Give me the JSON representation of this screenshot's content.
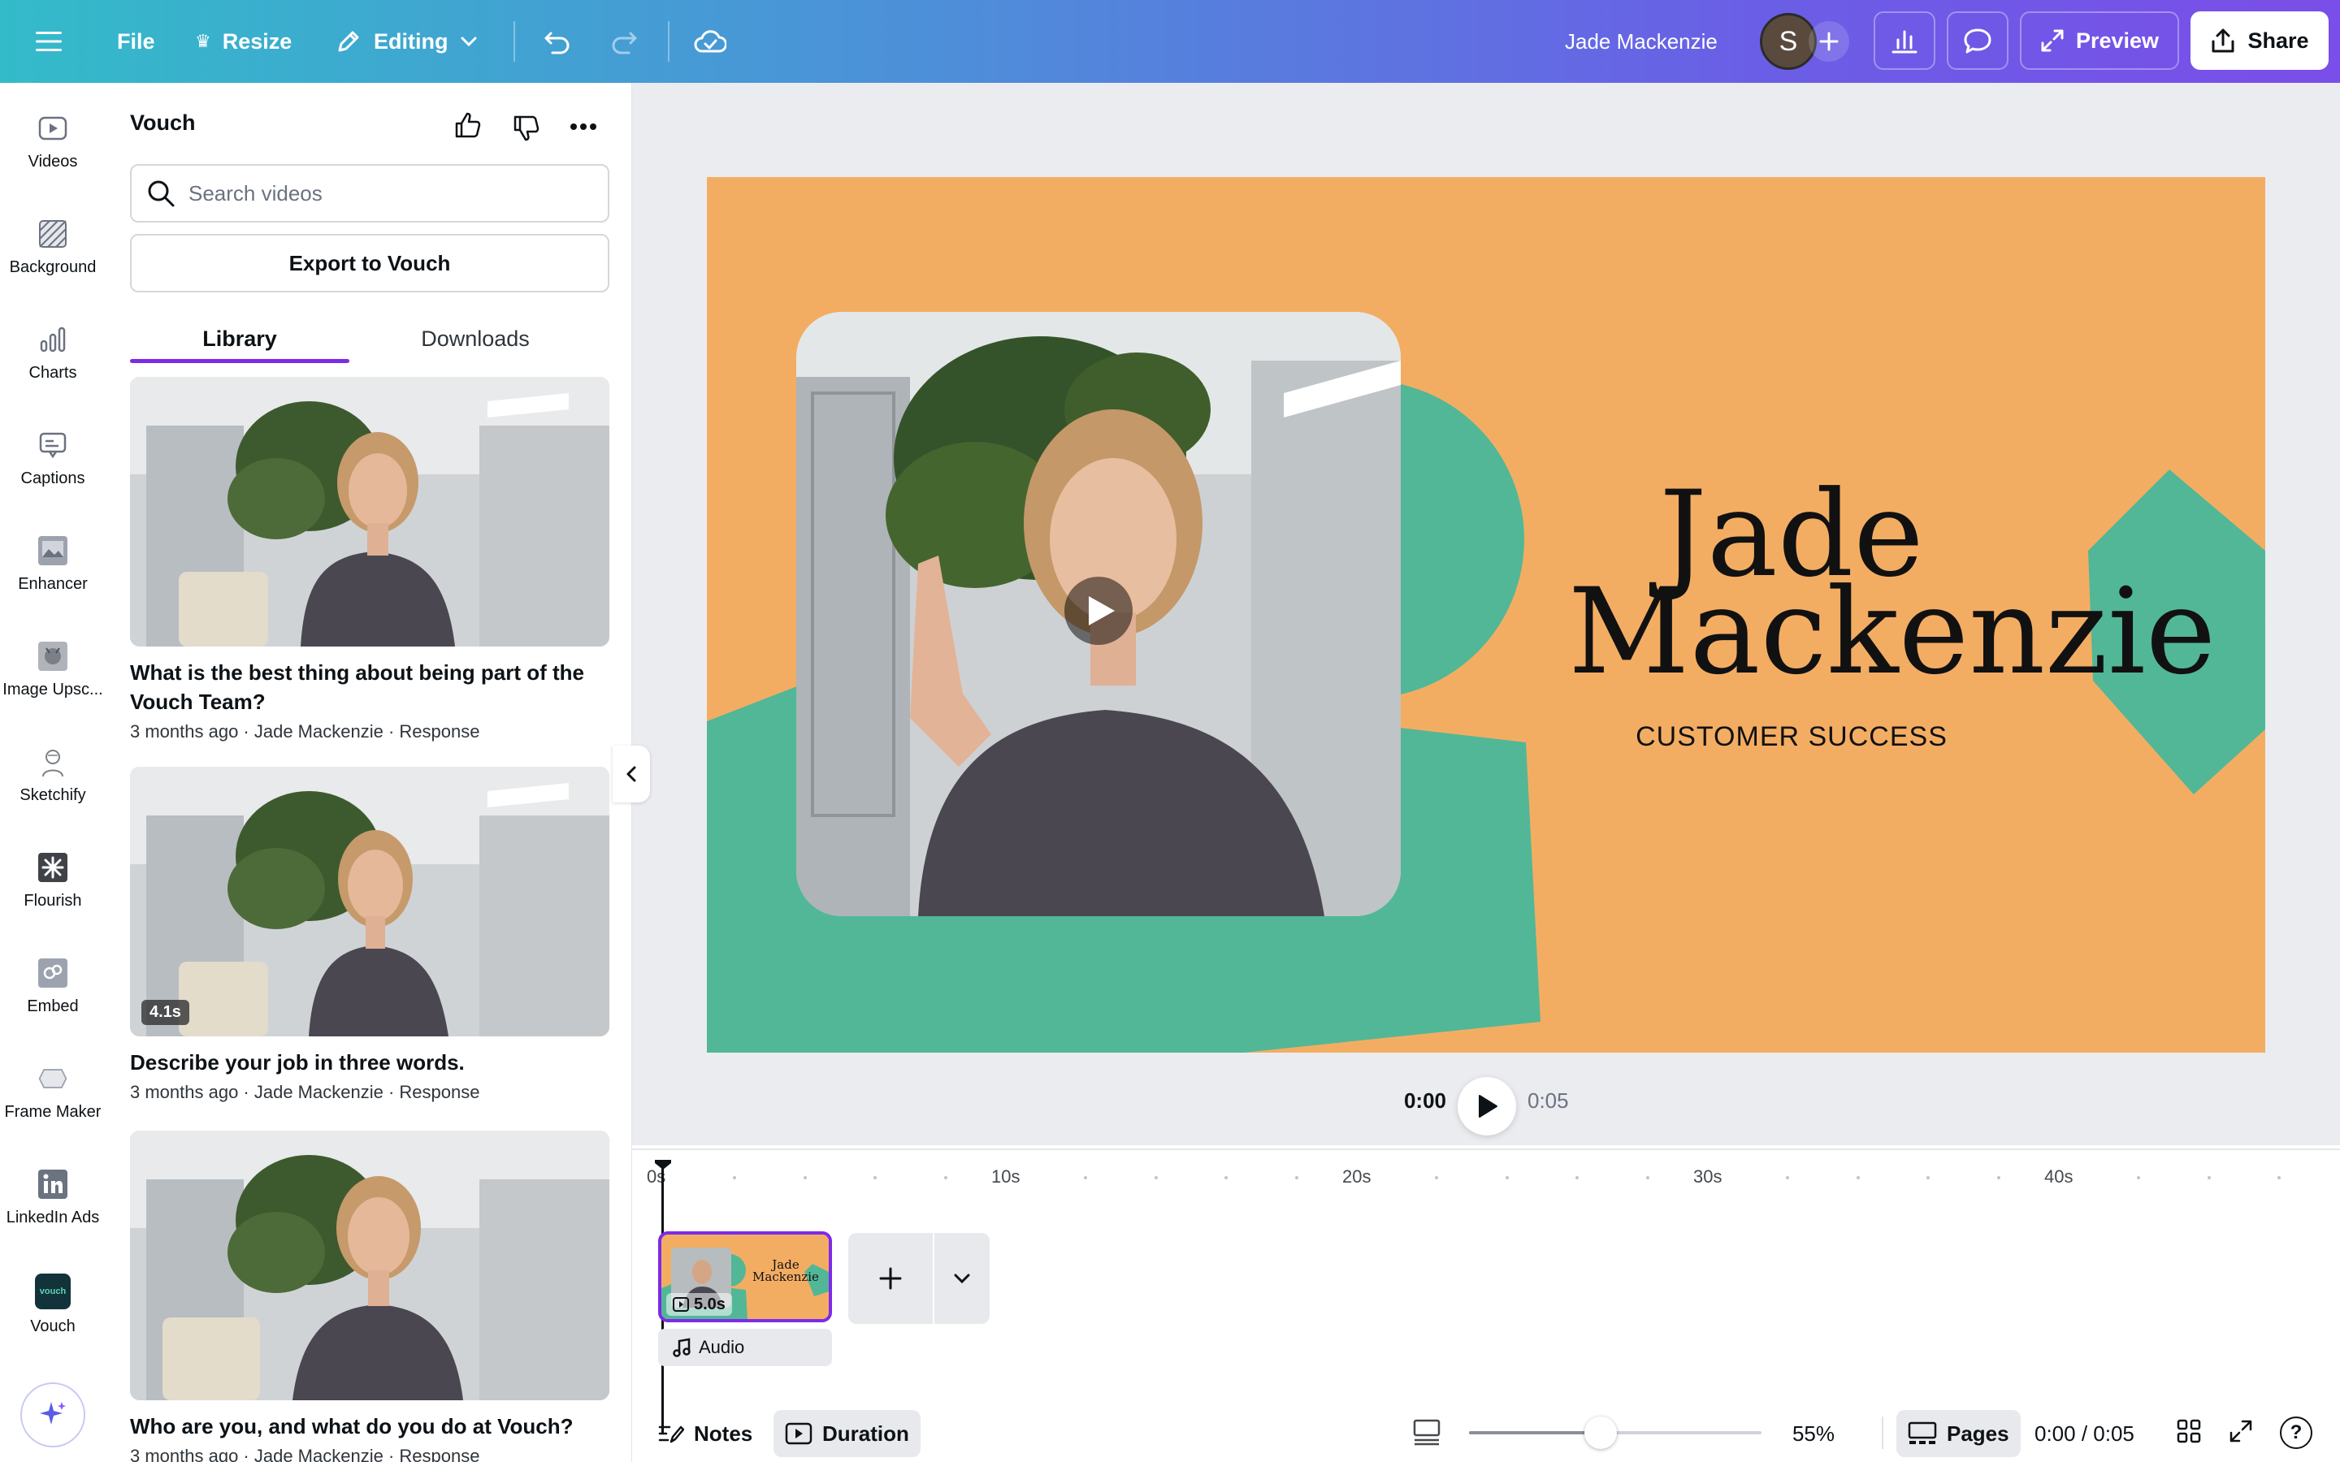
{
  "topbar": {
    "file_label": "File",
    "resize_label": "Resize",
    "editing_label": "Editing",
    "user_name": "Jade Mackenzie",
    "avatar_initial": "S",
    "preview_label": "Preview",
    "share_label": "Share"
  },
  "rail": {
    "items": [
      {
        "label": "Videos",
        "icon": "video-icon"
      },
      {
        "label": "Background",
        "icon": "background-icon"
      },
      {
        "label": "Charts",
        "icon": "chart-icon"
      },
      {
        "label": "Captions",
        "icon": "captions-icon"
      },
      {
        "label": "Enhancer",
        "icon": "enhancer-icon"
      },
      {
        "label": "Image Upsc...",
        "icon": "upscaler-icon"
      },
      {
        "label": "Sketchify",
        "icon": "sketch-icon"
      },
      {
        "label": "Flourish",
        "icon": "flourish-icon"
      },
      {
        "label": "Embed",
        "icon": "embed-icon"
      },
      {
        "label": "Frame Maker",
        "icon": "frame-icon"
      },
      {
        "label": "LinkedIn Ads",
        "icon": "linkedin-icon"
      },
      {
        "label": "Vouch",
        "icon": "vouch-icon",
        "badge": "vouch"
      }
    ]
  },
  "panel": {
    "title": "Vouch",
    "search_placeholder": "Search videos",
    "export_label": "Export to Vouch",
    "tabs": [
      "Library",
      "Downloads"
    ],
    "active_tab": "Library",
    "videos": [
      {
        "title": "What is the best thing about being part of the Vouch Team?",
        "meta": "3 months ago · Jade Mackenzie · Response",
        "duration": ""
      },
      {
        "title": "Describe your job in three words.",
        "meta": "3 months ago · Jade Mackenzie · Response",
        "duration": "4.1s"
      },
      {
        "title": "Who are you, and what do you do at Vouch?",
        "meta": "3 months ago · Jade Mackenzie · Response",
        "duration": ""
      }
    ]
  },
  "slide": {
    "name_line1": "Jade",
    "name_line2": "Mackenzie",
    "role": "CUSTOMER SUCCESS",
    "colors": {
      "background": "#f3ad63",
      "accent": "#52b797",
      "text": "#111111"
    }
  },
  "playback": {
    "current": "0:00",
    "total": "0:05"
  },
  "timeline": {
    "ticks": [
      "0s",
      "10s",
      "20s",
      "30s",
      "40s"
    ],
    "clip_duration": "5.0s",
    "clip_title_line1": "Jade",
    "clip_title_line2": "Mackenzie",
    "audio_label": "Audio"
  },
  "bottombar": {
    "notes_label": "Notes",
    "duration_label": "Duration",
    "zoom": "55%",
    "zoom_fraction": 0.45,
    "pages_label": "Pages",
    "time_readout": "0:00 / 0:05",
    "help_label": "?"
  }
}
